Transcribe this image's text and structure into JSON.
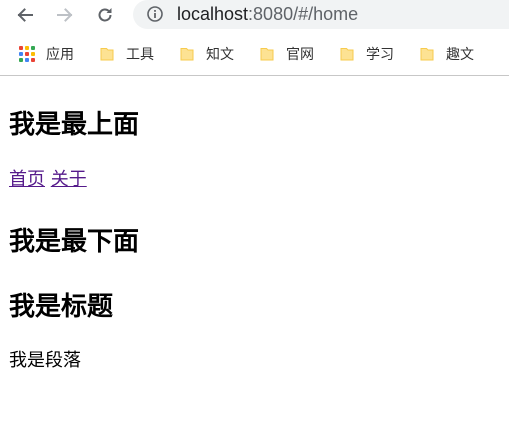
{
  "browser": {
    "url_host": "localhost",
    "url_rest": ":8080/#/home",
    "bookmarks": [
      {
        "label": "应用",
        "icon": "apps-grid-icon"
      },
      {
        "label": "工具",
        "icon": "folder-icon"
      },
      {
        "label": "知文",
        "icon": "folder-icon"
      },
      {
        "label": "官网",
        "icon": "folder-icon"
      },
      {
        "label": "学习",
        "icon": "folder-icon"
      },
      {
        "label": "趣文",
        "icon": "folder-icon"
      }
    ]
  },
  "page": {
    "top_heading": "我是最上面",
    "nav_links": [
      {
        "label": "首页"
      },
      {
        "label": "关于"
      }
    ],
    "bottom_heading": "我是最下面",
    "title_heading": "我是标题",
    "paragraph": "我是段落"
  },
  "colors": {
    "visited_link": "#551a8b",
    "omnibox_bg": "#f1f3f4",
    "folder": "#fde293",
    "folder_edge": "#f7cb4d"
  }
}
